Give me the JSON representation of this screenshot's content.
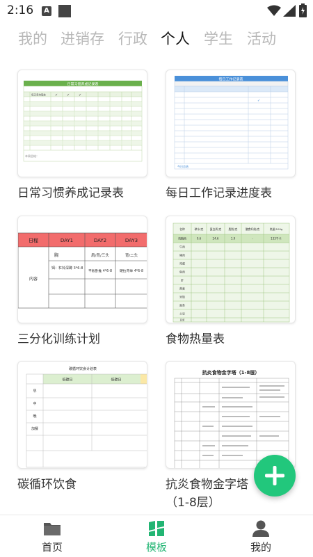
{
  "status": {
    "time": "2:16",
    "notif_label": "A"
  },
  "tabs": [
    {
      "label": "我的",
      "active": false
    },
    {
      "label": "进销存",
      "active": false
    },
    {
      "label": "行政",
      "active": false
    },
    {
      "label": "个人",
      "active": true
    },
    {
      "label": "学生",
      "active": false
    },
    {
      "label": "活动",
      "active": false
    }
  ],
  "templates": [
    {
      "title": "日常习惯养成记录表",
      "thumb": {
        "heading": "日常习惯养成记录表",
        "first_row": "每天坚持锻炼",
        "footer": "本周总结："
      }
    },
    {
      "title": "每日工作记录进度表",
      "thumb": {
        "heading": "每日工作记录表",
        "footer": "今日总结"
      }
    },
    {
      "title": "三分化训练计划",
      "thumb": {
        "headers": [
          "日程",
          "DAY1",
          "DAY2",
          "DAY3"
        ],
        "row_label": "内容",
        "day1": [
          "胸",
          "饵：杠铃深蹲 3*6-8"
        ],
        "day2": [
          "肩/背/三头",
          "平板卧推 4*6-8"
        ],
        "day3": [
          "背/二头",
          "硬拉弯举 4*6-8"
        ]
      }
    },
    {
      "title": "食物热量表",
      "thumb": {
        "headers": [
          "名称",
          "碳水/克",
          "蛋白质/克",
          "脂肪/克",
          "膳食纤维/克",
          "热量/100g"
        ],
        "first_row": [
          "鸡胸肉",
          "0.6",
          "24.6",
          "1.9",
          "-",
          "133千卡"
        ],
        "foods": [
          "牛肉",
          "猪肉",
          "鸡蛋",
          "鱼肉",
          "虾",
          "燕麦",
          "米饭",
          "面条",
          "土豆",
          "豆浆"
        ]
      }
    },
    {
      "title": "碳循环饮食",
      "thumb": {
        "heading": "碳循环饮食计划表",
        "cols": [
          "低碳日",
          "低碳日"
        ],
        "meals": [
          "早",
          "中",
          "晚",
          "加餐"
        ]
      }
    },
    {
      "title": "抗炎食物金字塔（1-8层）",
      "thumb": {
        "heading": "抗炎食物金字塔（1-8层）"
      }
    }
  ],
  "bottom_nav": [
    {
      "label": "首页",
      "icon": "folder-icon",
      "active": false
    },
    {
      "label": "模板",
      "icon": "template-icon",
      "active": true
    },
    {
      "label": "我的",
      "icon": "person-icon",
      "active": false
    }
  ],
  "colors": {
    "accent": "#22b573",
    "fab": "#22c77c",
    "table_green": "#6ab04c",
    "table_blue": "#4a90d9",
    "table_red": "#f26c6c"
  }
}
